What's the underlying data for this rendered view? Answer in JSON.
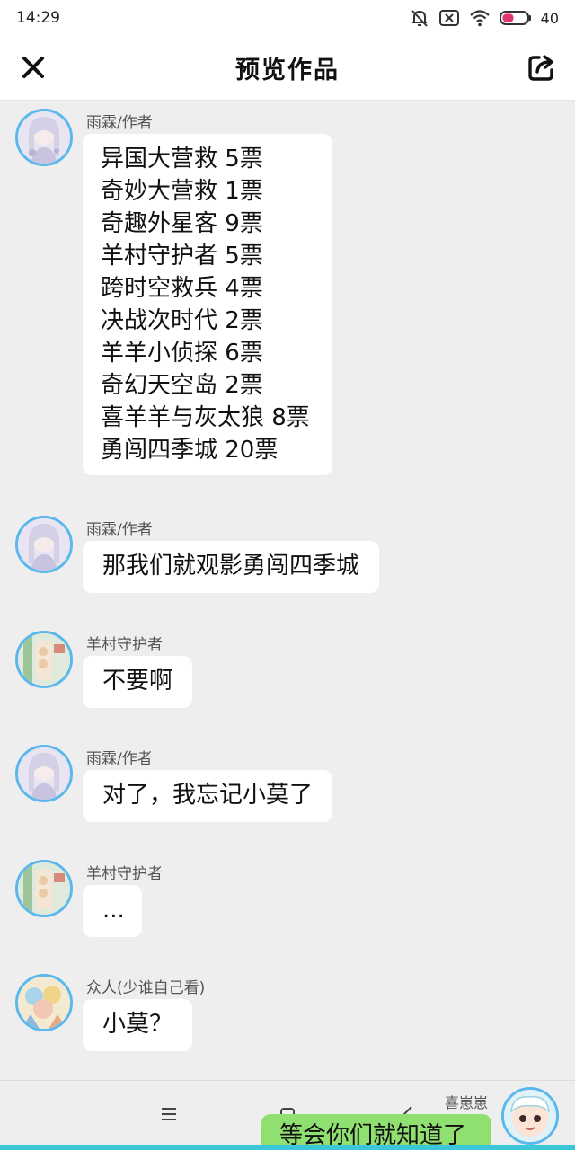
{
  "status_bar": {
    "time": "14:29",
    "battery": "40"
  },
  "header": {
    "title": "预览作品"
  },
  "messages": [
    {
      "sender": "雨霖/作者",
      "lines": [
        "异国大营救 5票",
        "奇妙大营救 1票",
        "奇趣外星客 9票",
        "羊村守护者 5票",
        "跨时空救兵 4票",
        "决战次时代 2票",
        "羊羊小侦探 6票",
        "奇幻天空岛 2票",
        "喜羊羊与灰太狼 8票",
        "勇闯四季城 20票"
      ]
    },
    {
      "sender": "雨霖/作者",
      "text": "那我们就观影勇闯四季城"
    },
    {
      "sender": "羊村守护者",
      "text": "不要啊"
    },
    {
      "sender": "雨霖/作者",
      "text": "对了，我忘记小莫了"
    },
    {
      "sender": "羊村守护者",
      "text": "..."
    },
    {
      "sender": "众人(少谁自己看)",
      "text": "小莫？"
    }
  ],
  "self_message": {
    "sender": "喜崽崽",
    "text": "等会你们就知道了"
  },
  "colors": {
    "avatar_ring": "#5bb8ec",
    "self_bubble": "#8fe070",
    "background": "#eeeeee"
  }
}
